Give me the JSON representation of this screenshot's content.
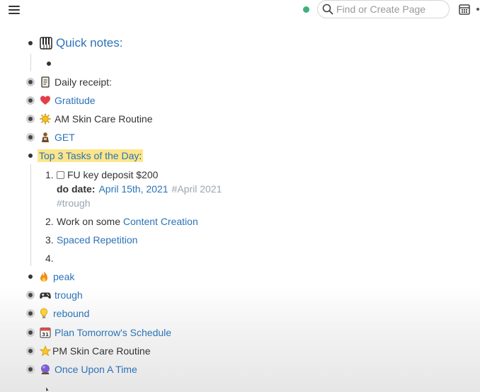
{
  "header": {
    "search_placeholder": "Find or Create Page"
  },
  "page": {
    "quick_notes": {
      "icon": "piano-keys-icon",
      "label": "Quick notes:"
    },
    "daily_receipt": {
      "icon": "scroll-icon",
      "label": "Daily receipt:"
    },
    "gratitude": {
      "icon": "heart-icon",
      "label": "Gratitude"
    },
    "am_skin": {
      "icon": "sun-icon",
      "label": "AM Skin Care Routine"
    },
    "get": {
      "icon": "person-icon",
      "label": "GET"
    },
    "top3": {
      "label": "Top 3 Tasks of the Day",
      "suffix": ":"
    },
    "tasks": [
      {
        "number": "1.",
        "text": "FU key deposit $200"
      },
      {
        "number": "2.",
        "text": "Work on some ",
        "link": "Content Creation"
      },
      {
        "number": "3.",
        "link": "Spaced Repetition"
      },
      {
        "number": "4."
      }
    ],
    "do_date": {
      "label": "do date:",
      "date": "April 15th, 2021",
      "tag1": "#April 2021",
      "tag2": "#trough"
    },
    "peak": {
      "icon": "fire-icon",
      "label": "peak"
    },
    "trough": {
      "icon": "game-controller-icon",
      "label": "trough"
    },
    "rebound": {
      "icon": "lightbulb-icon",
      "label": "rebound"
    },
    "plan": {
      "icon": "calendar-icon",
      "label": "Plan Tomorrow's Schedule"
    },
    "pm_skin": {
      "icon": "star-icon",
      "label": "PM Skin Care Routine"
    },
    "once": {
      "icon": "crystal-ball-icon",
      "label": "Once Upon A Time"
    }
  }
}
